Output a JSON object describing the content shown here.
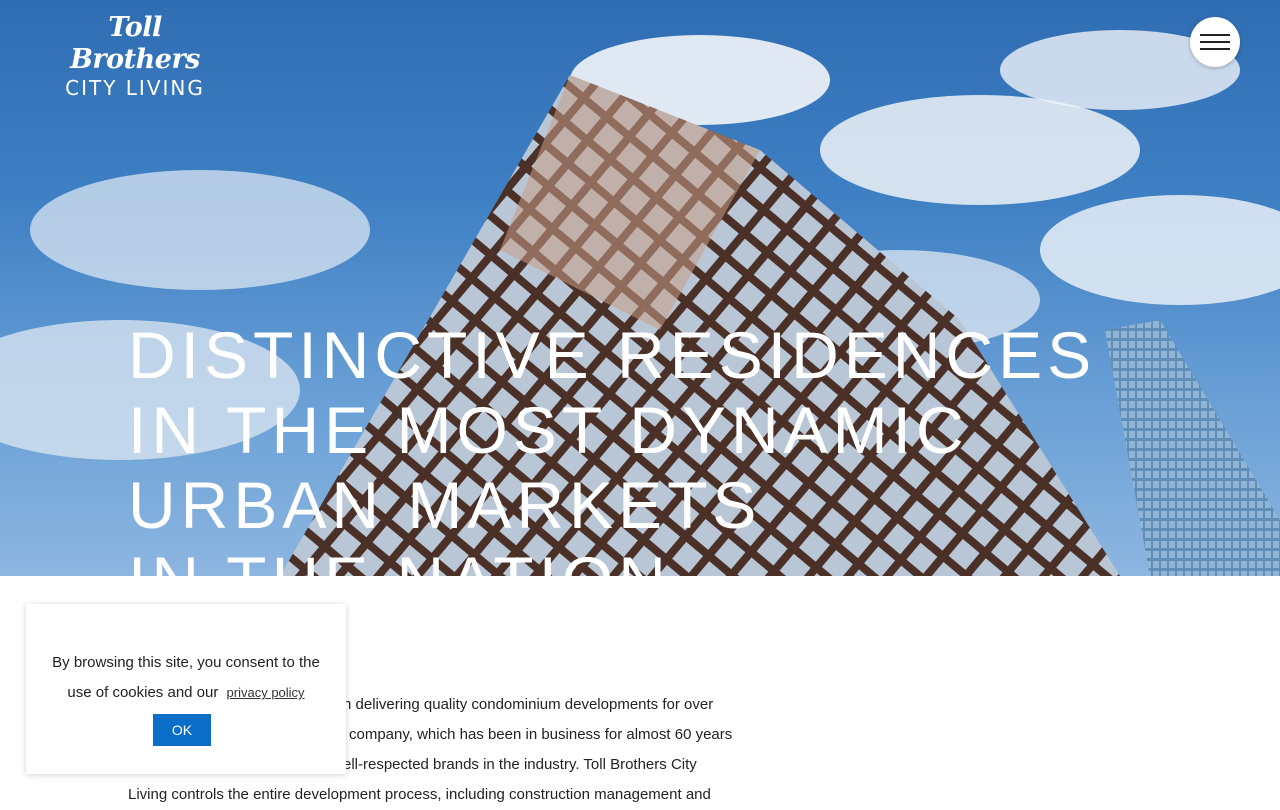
{
  "logo": {
    "brand": "Toll Brothers",
    "sub": "CITY LIVING"
  },
  "hero": {
    "headline_lines": [
      "DISTINCTIVE RESIDENCES",
      "IN THE MOST DYNAMIC",
      "URBAN MARKETS",
      "IN THE NATION"
    ]
  },
  "intro": {
    "lines": [
      "n delivering quality condominium developments for over",
      "company, which has been in business for almost 60 years",
      "ell-respected brands in the industry. Toll Brothers City",
      "Living controls the entire development process, including construction management and"
    ]
  },
  "cookie": {
    "message": "By browsing this site, you consent to the use of cookies and our",
    "link": "privacy policy",
    "ok_label": "OK"
  },
  "menu": {
    "icon": "hamburger-icon"
  },
  "colors": {
    "accent": "#0a6ec8",
    "sky": "#3f80c4"
  }
}
